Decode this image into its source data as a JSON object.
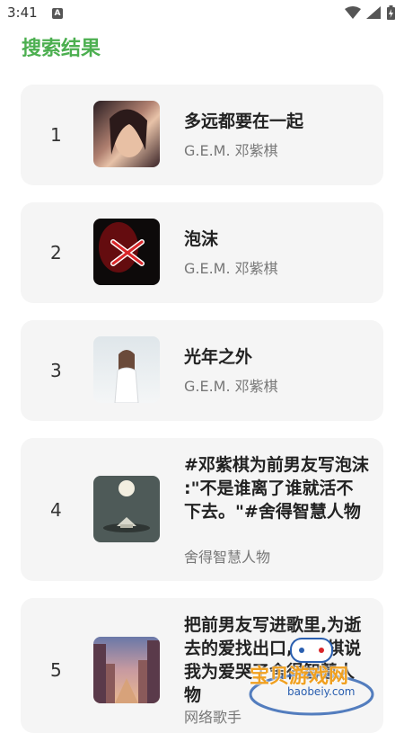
{
  "status_bar": {
    "time": "3:41",
    "notification_letter": "A"
  },
  "page": {
    "title": "搜索结果"
  },
  "results": [
    {
      "rank": "1",
      "title": "多远都要在一起",
      "artist": "G.E.M. 邓紫棋"
    },
    {
      "rank": "2",
      "title": "泡沫",
      "artist": "G.E.M. 邓紫棋"
    },
    {
      "rank": "3",
      "title": "光年之外",
      "artist": "G.E.M. 邓紫棋"
    },
    {
      "rank": "4",
      "title": "#邓紫棋为前男友写泡沫 :\"不是谁离了谁就活不下去。\"#舍得智慧人物",
      "artist": "舍得智慧人物"
    },
    {
      "rank": "5",
      "title": "把前男友写进歌里,为逝去的爱找出口,邓紫棋说我为爱哭了舍得智慧人物",
      "artist": "网络歌手"
    }
  ],
  "watermark": {
    "title": "宝贝游戏网",
    "url": "baobeiy.com"
  },
  "colors": {
    "accent": "#4caf50",
    "card_bg": "#f5f5f5"
  }
}
